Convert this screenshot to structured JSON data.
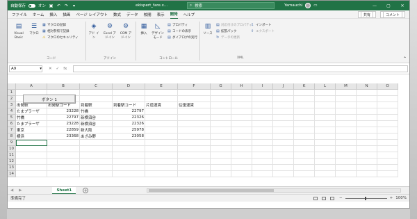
{
  "titlebar": {
    "autosave_label": "自動保存",
    "autosave_state": "オン",
    "file_name": "ekispert_fare.x...",
    "search_placeholder": "検索",
    "user_name": "Yamauchi",
    "brand_color": "#217346"
  },
  "menu": {
    "tabs": [
      "ファイル",
      "ホーム",
      "挿入",
      "描画",
      "ページ レイアウト",
      "数式",
      "データ",
      "校閲",
      "表示",
      "開発",
      "ヘルプ"
    ],
    "active_tab": "開発",
    "share_label": "共有",
    "comment_label": "コメント"
  },
  "ribbon": {
    "code": {
      "visual_basic": "Visual Basic",
      "macro": "マクロ",
      "record_macro": "マクロの記録",
      "relative_ref": "相対参照で記録",
      "macro_security": "マクロのセキュリティ",
      "group_label": "コード"
    },
    "addins": {
      "addin": "アド イン",
      "excel_addin": "Excel アドイン",
      "com_addin": "COM アドイン",
      "group_label": "アドイン"
    },
    "controls": {
      "insert": "挿入",
      "design_mode": "デザイン モード",
      "properties": "プロパティ",
      "view_code": "コードの表示",
      "run_dialog": "ダイアログの実行",
      "group_label": "コントロール"
    },
    "xml": {
      "source": "ソース",
      "map_properties": "対応付けのプロパティ",
      "expansion_packs": "拡張パック",
      "refresh_data": "データの更新",
      "import": "インポート",
      "export": "エクスポート",
      "group_label": "XML"
    }
  },
  "formula_bar": {
    "name_box": "A9",
    "fx": "fx",
    "content": ""
  },
  "sheet": {
    "columns": [
      "A",
      "B",
      "C",
      "D",
      "E",
      "F",
      "G",
      "H",
      "I",
      "J",
      "K",
      "L",
      "M",
      "N",
      "O"
    ],
    "rows": [
      "1",
      "2",
      "3",
      "4",
      "5",
      "6",
      "7",
      "8",
      "9",
      "10",
      "11",
      "12",
      "13",
      "14"
    ],
    "button_label": "ボタン 1",
    "headers": [
      "出発駅",
      "出発駅コード",
      "到着駅",
      "到着駅コード",
      "片道運賃",
      "往復運賃"
    ],
    "data": [
      [
        "たまプラーザ",
        "23228",
        "竹橋",
        "22797"
      ],
      [
        "竹橋",
        "22797",
        "新横須谷",
        "22326"
      ],
      [
        "たまプラーザ",
        "23228",
        "新横須谷",
        "22326"
      ],
      [
        "東京",
        "22859",
        "新大阪",
        "25978"
      ],
      [
        "横浜",
        "23368",
        "あざみ野",
        "23058"
      ]
    ],
    "selected_cell": "A9"
  },
  "sheet_tabs": {
    "tab_name": "Sheet1",
    "add_sheet": "+"
  },
  "status_bar": {
    "ready": "準備完了",
    "zoom": "100%"
  }
}
